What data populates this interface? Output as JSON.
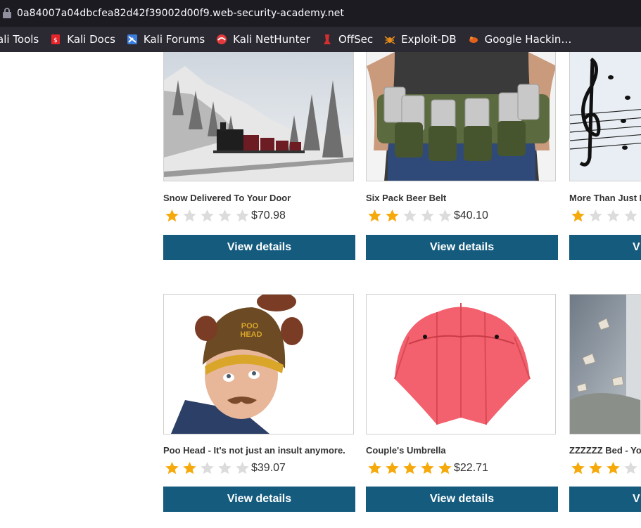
{
  "browser": {
    "url": "0a84007a04dbcfea82d42f39002d00f9.web-security-academy.net",
    "bookmarks": [
      {
        "label": "ali Tools",
        "icon": "kali-tools-icon"
      },
      {
        "label": "Kali Docs",
        "icon": "kali-docs-icon"
      },
      {
        "label": "Kali Forums",
        "icon": "kali-forums-icon"
      },
      {
        "label": "Kali NetHunter",
        "icon": "kali-nethunter-icon"
      },
      {
        "label": "OffSec",
        "icon": "offsec-icon"
      },
      {
        "label": "Exploit-DB",
        "icon": "exploit-db-icon"
      },
      {
        "label": "Google Hackin…",
        "icon": "google-hacking-icon"
      }
    ]
  },
  "products": [
    {
      "name": "Snow Delivered To Your Door",
      "rating": 1,
      "price": "$70.98",
      "button": "View details",
      "image": "snowy-train-image"
    },
    {
      "name": "Six Pack Beer Belt",
      "rating": 2,
      "price": "$40.10",
      "button": "View details",
      "image": "beer-belt-image"
    },
    {
      "name": "More Than Just B",
      "rating": 1,
      "price": "",
      "button": "V",
      "image": "music-notes-image"
    },
    {
      "name": "Poo Head - It's not just an insult anymore.",
      "rating": 2,
      "price": "$39.07",
      "button": "View details",
      "image": "poo-head-image"
    },
    {
      "name": "Couple's Umbrella",
      "rating": 5,
      "price": "$22.71",
      "button": "View details",
      "image": "umbrella-image"
    },
    {
      "name": "ZZZZZZ Bed - Yo",
      "rating": 3,
      "price": "",
      "button": "V",
      "image": "bed-books-image"
    }
  ],
  "colors": {
    "button": "#145b7e",
    "star_filled": "#f5a90a",
    "star_empty": "#dcdcdc"
  }
}
